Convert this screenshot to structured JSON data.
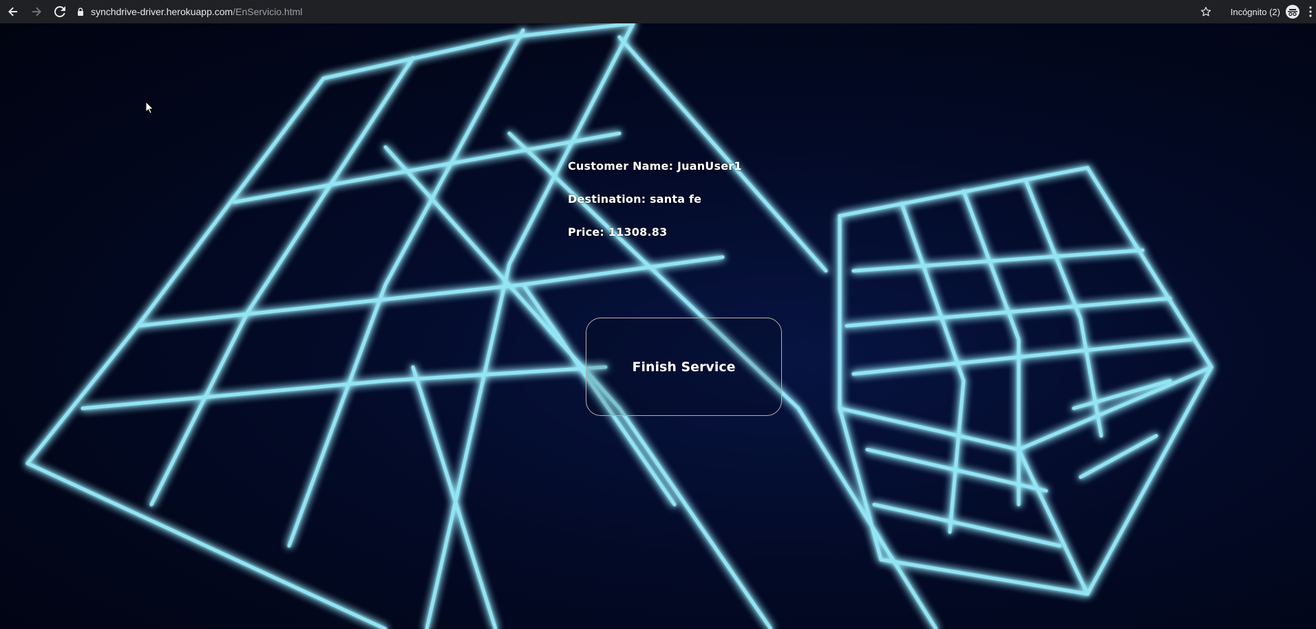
{
  "browser": {
    "url_host": "synchdrive-driver.herokuapp.com",
    "url_path": "/EnServicio.html",
    "incognito_label": "Incógnito (2)",
    "icons": [
      "back-arrow-icon",
      "forward-arrow-icon",
      "reload-icon",
      "lock-icon",
      "star-icon",
      "incognito-icon",
      "kebab-menu-icon"
    ]
  },
  "service": {
    "customer_name": "Customer Name: JuanUser1",
    "destination": "Destination: santa fe",
    "price": "Price: 11308.83",
    "finish_button_label": "Finish Service"
  },
  "colors": {
    "background": "#01030d",
    "glow": "#7fe9ff",
    "button_border": "#b8b4a8",
    "text": "#ffffff"
  }
}
